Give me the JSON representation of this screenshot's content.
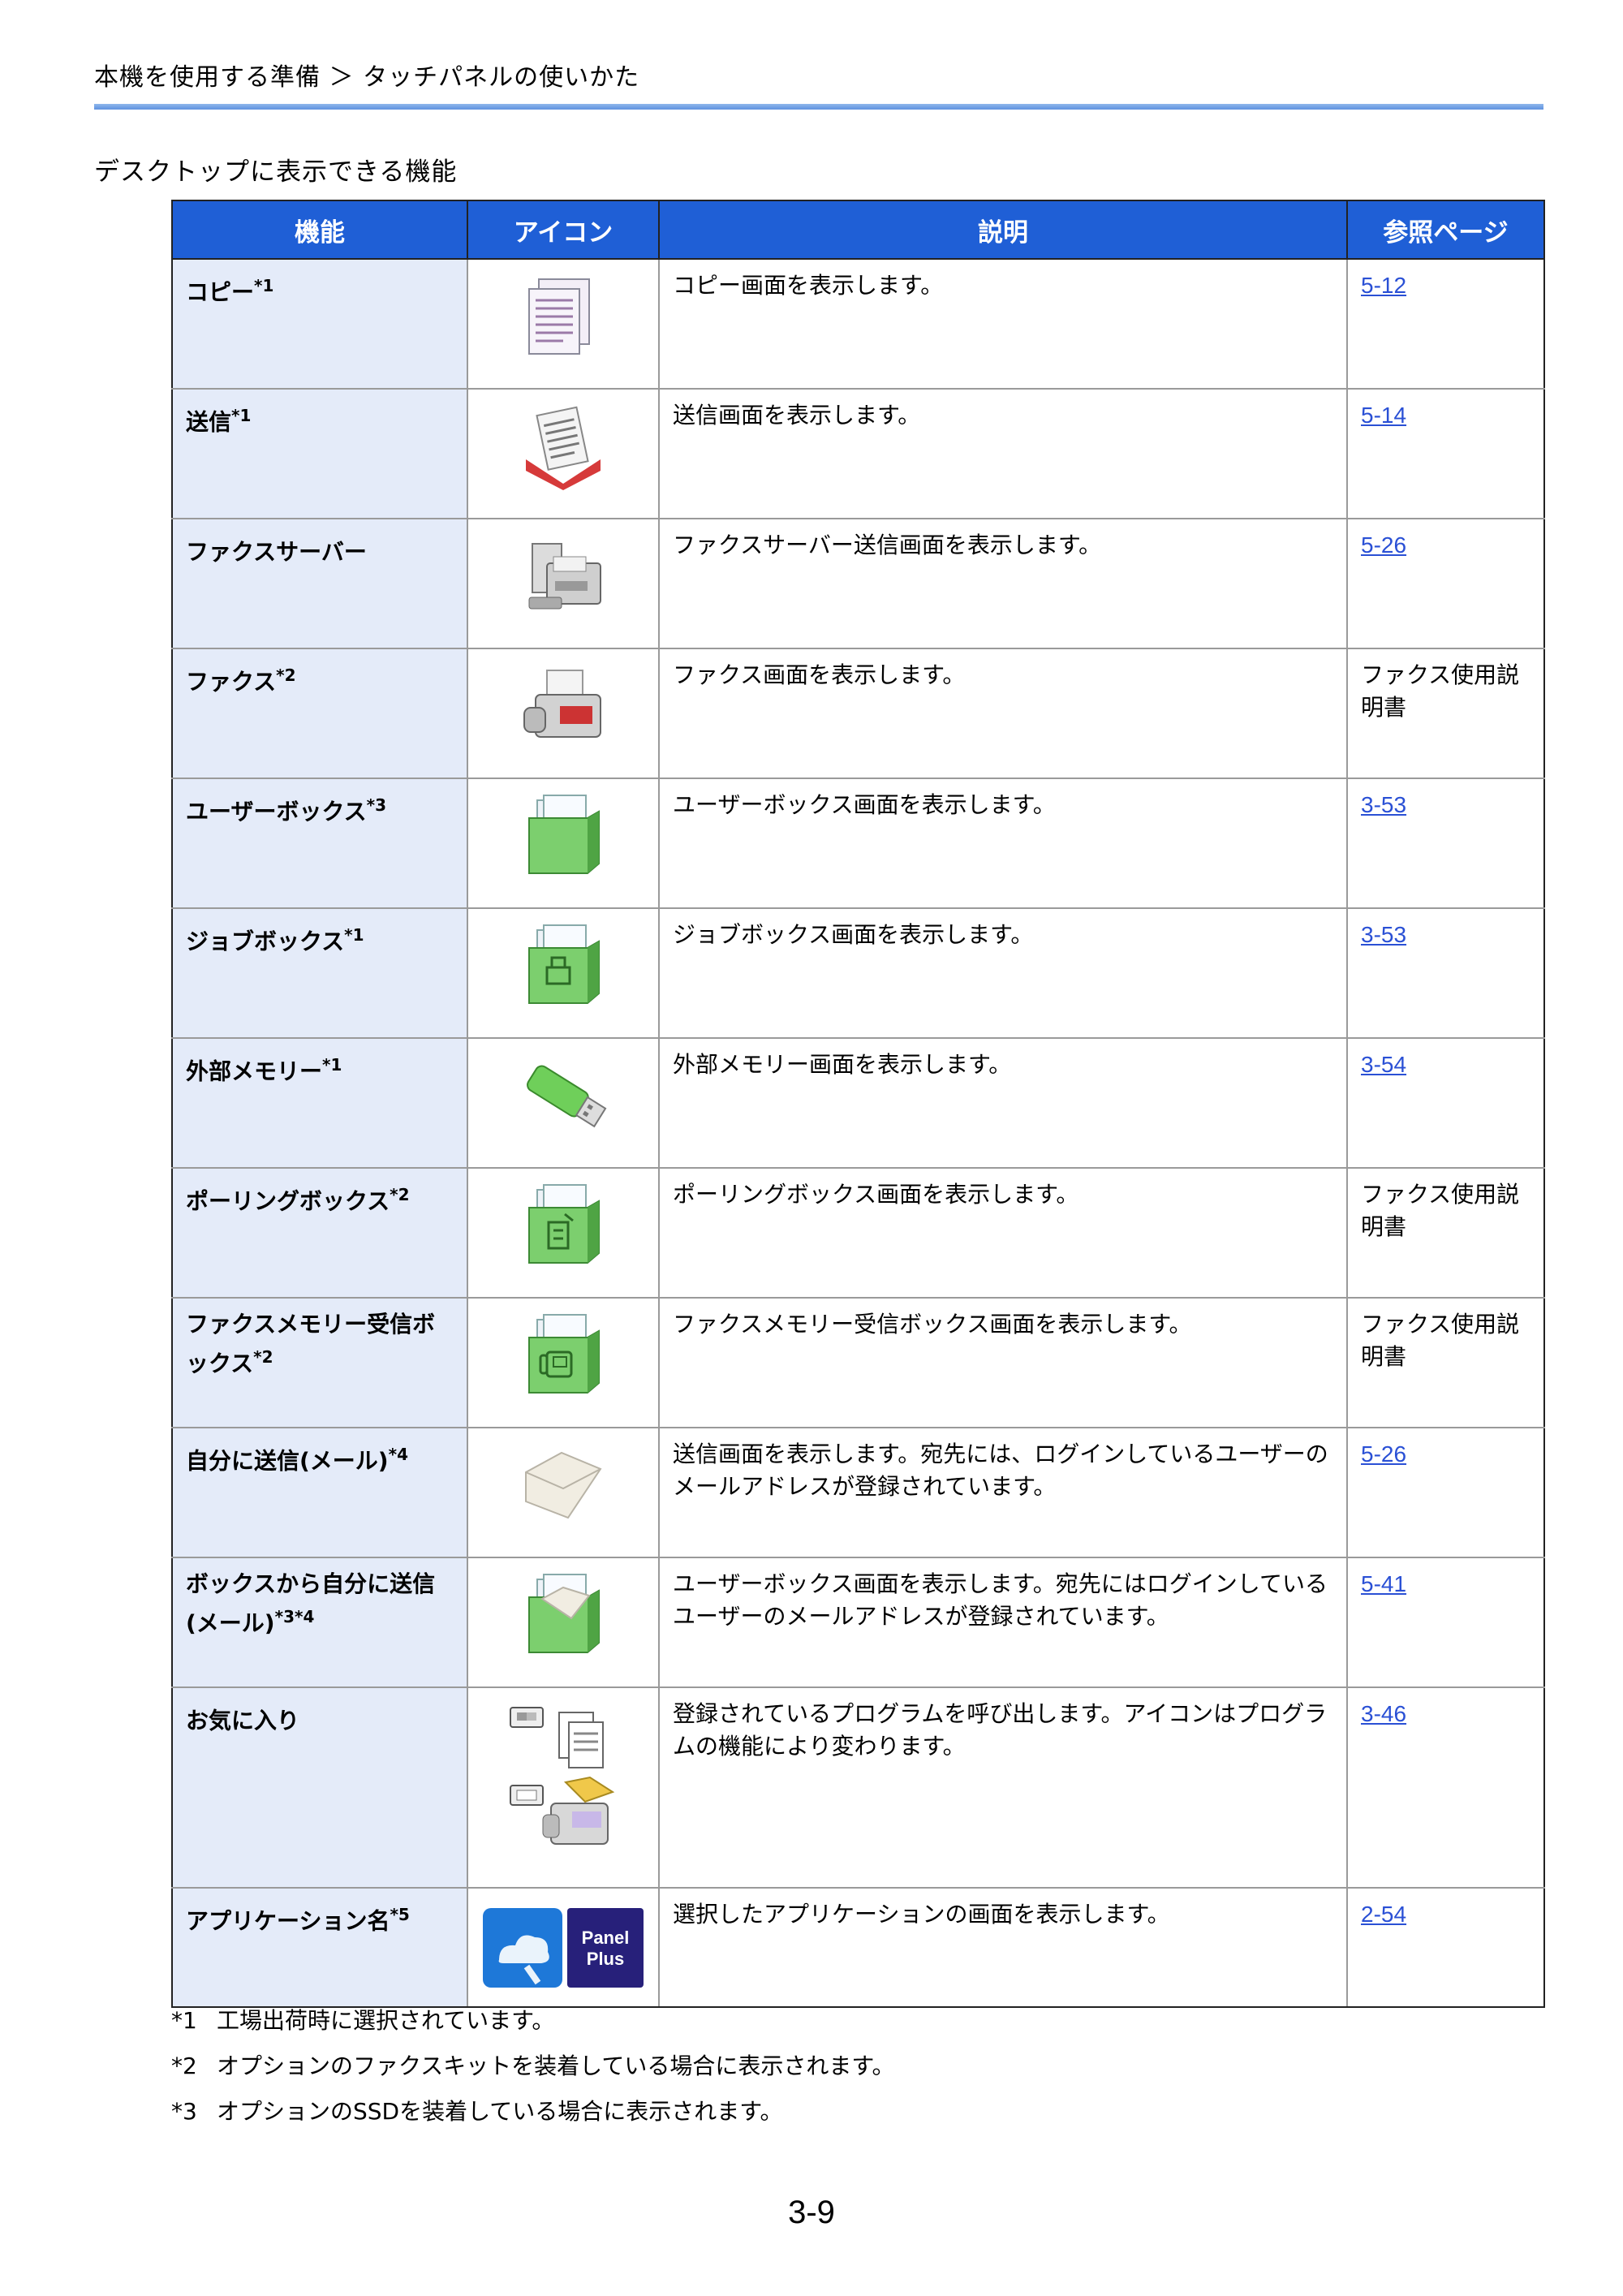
{
  "header": {
    "breadcrumb": "本機を使用する準備 ＞ タッチパネルの使いかた"
  },
  "section": {
    "title": "デスクトップに表示できる機能"
  },
  "table": {
    "columns": [
      "機能",
      "アイコン",
      "説明",
      "参照ページ"
    ],
    "rows": [
      {
        "name": "コピー",
        "note": "*1",
        "icon": "copy-icon",
        "desc": "コピー画面を表示します。",
        "ref": "5-12",
        "ref_link": true
      },
      {
        "name": "送信",
        "note": "*1",
        "icon": "send-icon",
        "desc": "送信画面を表示します。",
        "ref": "5-14",
        "ref_link": true
      },
      {
        "name": "ファクスサーバー",
        "note": "",
        "icon": "fax-server-icon",
        "desc": "ファクスサーバー送信画面を表示します。",
        "ref": "5-26",
        "ref_link": true
      },
      {
        "name": "ファクス",
        "note": "*2",
        "icon": "fax-icon",
        "desc": "ファクス画面を表示します。",
        "ref": "ファクス使用説明書",
        "ref_link": false
      },
      {
        "name": "ユーザーボックス",
        "note": "*3",
        "icon": "user-box-icon",
        "desc": "ユーザーボックス画面を表示します。",
        "ref": "3-53",
        "ref_link": true
      },
      {
        "name": "ジョブボックス",
        "note": "*1",
        "icon": "job-box-icon",
        "desc": "ジョブボックス画面を表示します。",
        "ref": "3-53",
        "ref_link": true
      },
      {
        "name": "外部メモリー",
        "note": "*1",
        "icon": "usb-memory-icon",
        "desc": "外部メモリー画面を表示します。",
        "ref": "3-54",
        "ref_link": true
      },
      {
        "name": "ポーリングボックス",
        "note": "*2",
        "icon": "polling-box-icon",
        "desc": "ポーリングボックス画面を表示します。",
        "ref": "ファクス使用説明書",
        "ref_link": false
      },
      {
        "name": "ファクスメモリー受信ボックス",
        "note": "*2",
        "icon": "fax-memory-box-icon",
        "desc": "ファクスメモリー受信ボックス画面を表示します。",
        "ref": "ファクス使用説明書",
        "ref_link": false
      },
      {
        "name": "自分に送信(メール)",
        "note": "*4",
        "icon": "envelope-icon",
        "desc": "送信画面を表示します。宛先には、ログインしているユーザーのメールアドレスが登録されています。",
        "ref": "5-26",
        "ref_link": true
      },
      {
        "name": "ボックスから自分に送信(メール)",
        "note": "*3*4",
        "icon": "box-send-icon",
        "desc": "ユーザーボックス画面を表示します。宛先にはログインしているユーザーのメールアドレスが登録されています。",
        "ref": "5-41",
        "ref_link": true
      },
      {
        "name": "お気に入り",
        "note": "",
        "icon": "favorite-icon",
        "desc": "登録されているプログラムを呼び出します。アイコンはプログラムの機能により変わります。",
        "ref": "3-46",
        "ref_link": true
      },
      {
        "name": "アプリケーション名",
        "note": "*5",
        "icon": "application-icon",
        "desc": "選択したアプリケーションの画面を表示します。",
        "ref": "2-54",
        "ref_link": true
      }
    ],
    "app_badge": [
      "Panel",
      "Plus"
    ]
  },
  "notes": [
    {
      "num": "*1",
      "text": "工場出荷時に選択されています。"
    },
    {
      "num": "*2",
      "text": "オプションのファクスキットを装着している場合に表示されます。"
    },
    {
      "num": "*3",
      "text": "オプションのSSDを装着している場合に表示されます。"
    }
  ],
  "page_number": "3-9"
}
